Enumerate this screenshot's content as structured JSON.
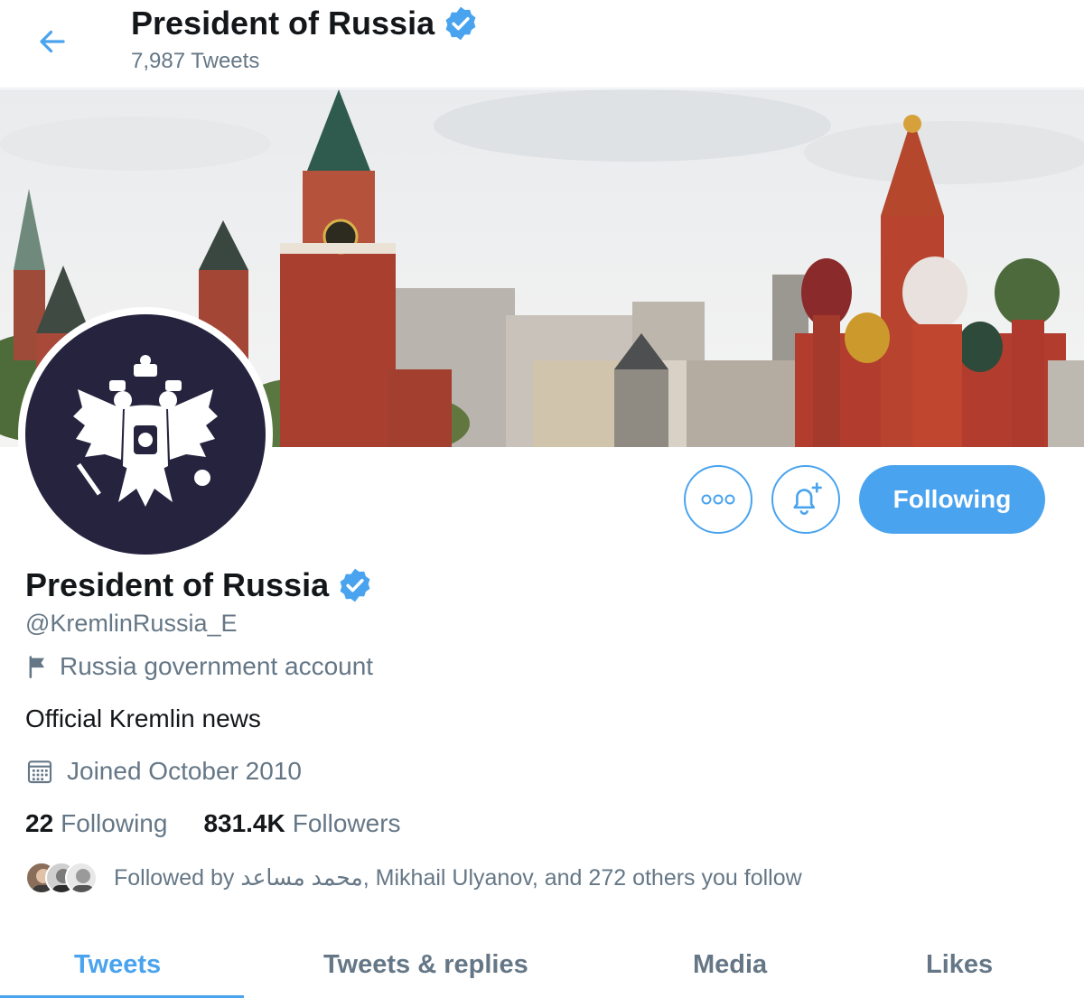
{
  "header": {
    "title": "President of Russia",
    "tweets_count": "7,987 Tweets",
    "back_icon": "arrow-left-icon",
    "verified_icon": "verified-badge-icon"
  },
  "actions": {
    "more_icon": "more-options-icon",
    "bell_icon": "notification-bell-plus-icon",
    "following_label": "Following"
  },
  "profile": {
    "name": "President of Russia",
    "handle": "@KremlinRussia_E",
    "label": "Russia government account",
    "bio": "Official Kremlin news",
    "joined": "Joined October 2010",
    "following_count": "22",
    "following_label": "Following",
    "followers_count": "831.4K",
    "followers_label": "Followers",
    "followed_by": "Followed by محمد مساعد, Mikhail Ulyanov, and 272 others you follow"
  },
  "tabs": [
    {
      "label": "Tweets",
      "active": true
    },
    {
      "label": "Tweets & replies",
      "active": false
    },
    {
      "label": "Media",
      "active": false
    },
    {
      "label": "Likes",
      "active": false
    }
  ],
  "colors": {
    "accent": "#4aa3ee",
    "text": "#14171a",
    "secondary": "#657786",
    "avatar_bg": "#26233f"
  }
}
